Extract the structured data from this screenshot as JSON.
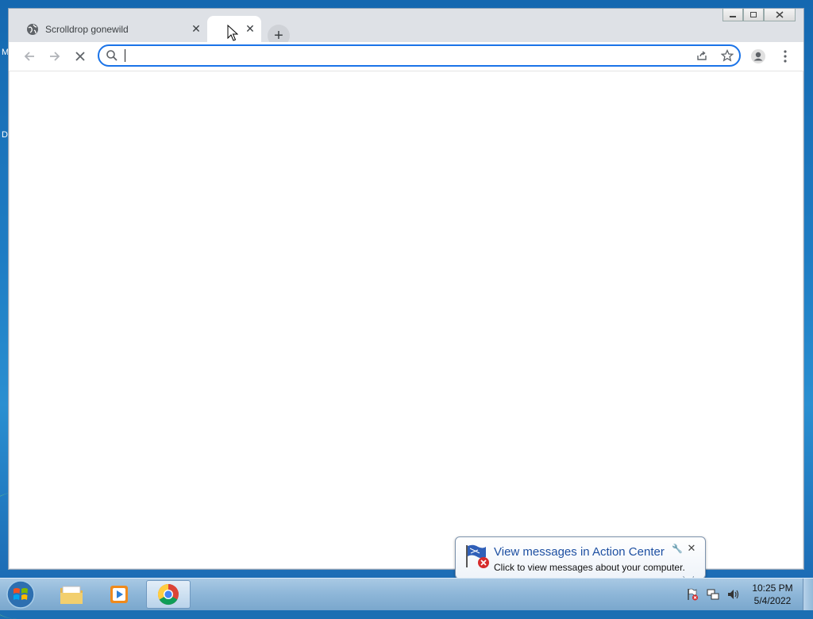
{
  "desktop": {
    "edge_letters": [
      "M",
      "D"
    ]
  },
  "browser": {
    "tabs": [
      {
        "title": "Scrolldrop gonewild",
        "active": false
      },
      {
        "title": "",
        "active": true
      }
    ],
    "new_tab_label": "+",
    "address": {
      "value": "",
      "placeholder": ""
    }
  },
  "notification": {
    "title": "View messages in Action Center",
    "text": "Click to view messages about your computer."
  },
  "taskbar": {
    "apps": [
      "file-explorer",
      "media-player",
      "chrome"
    ],
    "clock": {
      "time": "10:25 PM",
      "date": "5/4/2022"
    }
  },
  "colors": {
    "accent": "#1a73e8",
    "tab_bar": "#dee1e6",
    "taskbar": "#8db6d8"
  }
}
